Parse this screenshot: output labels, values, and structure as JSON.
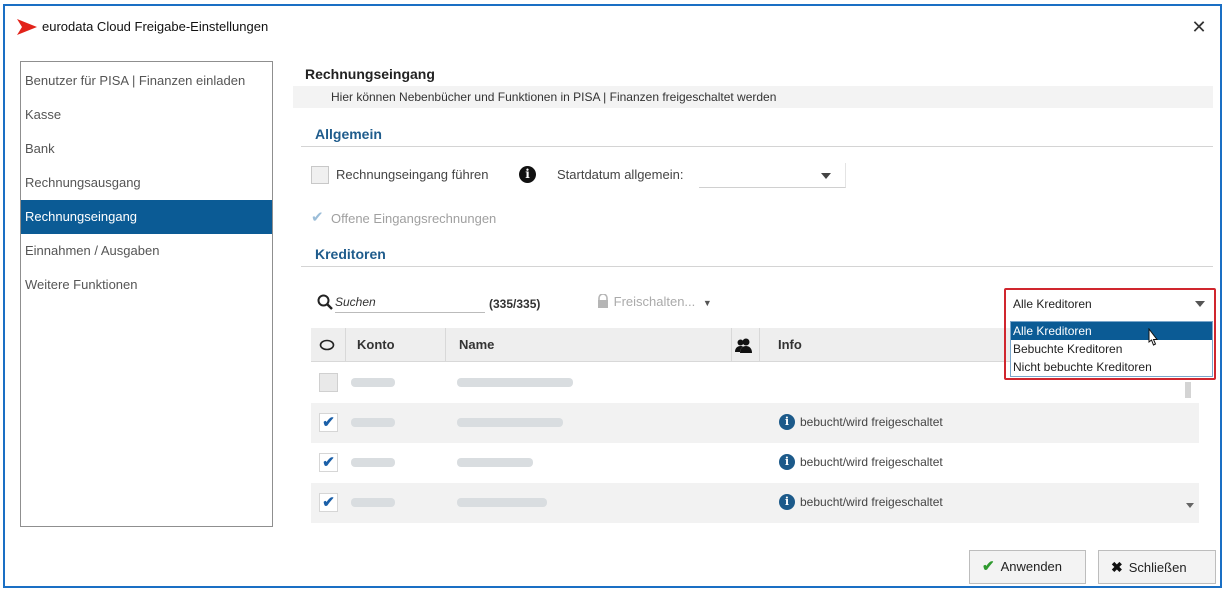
{
  "window": {
    "title": "eurodata Cloud Freigabe-Einstellungen",
    "close_glyph": "✕"
  },
  "sidebar": {
    "items": [
      {
        "label": "Benutzer für PISA | Finanzen einladen",
        "active": false
      },
      {
        "label": "Kasse",
        "active": false
      },
      {
        "label": "Bank",
        "active": false
      },
      {
        "label": "Rechnungsausgang",
        "active": false
      },
      {
        "label": "Rechnungseingang",
        "active": true
      },
      {
        "label": "Einnahmen / Ausgaben",
        "active": false
      },
      {
        "label": "Weitere Funktionen",
        "active": false
      }
    ]
  },
  "main": {
    "title": "Rechnungseingang",
    "subtitle": "Hier können Nebenbücher und Funktionen in PISA | Finanzen freigeschaltet werden",
    "allgemein": {
      "heading": "Allgemein",
      "rechnungseingang_label": "Rechnungseingang führen",
      "rechnungseingang_checked": false,
      "startdatum_label": "Startdatum allgemein:",
      "startdatum_value": "",
      "offene_label": "Offene Eingangsrechnungen",
      "offene_checked": true
    },
    "kreditoren": {
      "heading": "Kreditoren",
      "search_placeholder": "Suchen",
      "count": "(335/335)",
      "freischalten_label": "Freischalten...",
      "filter": {
        "selected": "Alle Kreditoren",
        "options": [
          "Alle Kreditoren",
          "Bebuchte Kreditoren",
          "Nicht bebuchte Kreditoren"
        ]
      },
      "columns": {
        "konto": "Konto",
        "name": "Name",
        "info": "Info"
      },
      "rows": [
        {
          "checked": false,
          "disabled": true,
          "info": ""
        },
        {
          "checked": true,
          "disabled": false,
          "info": "bebucht/wird freigeschaltet"
        },
        {
          "checked": true,
          "disabled": false,
          "info": "bebucht/wird freigeschaltet"
        },
        {
          "checked": true,
          "disabled": false,
          "info": "bebucht/wird freigeschaltet"
        }
      ]
    }
  },
  "footer": {
    "apply_label": "Anwenden",
    "close_label": "Schließen"
  },
  "colors": {
    "accent": "#0b5b95",
    "window_border": "#1a6fc4",
    "highlight": "#d0262e",
    "logo": "#e2231a"
  }
}
